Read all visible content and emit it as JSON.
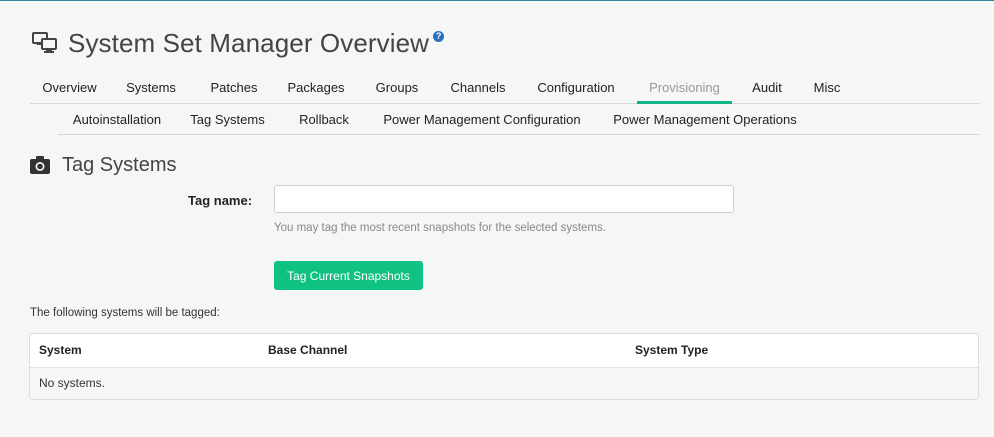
{
  "header": {
    "title": "System Set Manager Overview",
    "help_glyph": "?"
  },
  "tabs": [
    {
      "label": "Overview",
      "active": false
    },
    {
      "label": "Systems",
      "active": false
    },
    {
      "label": "Patches",
      "active": false
    },
    {
      "label": "Packages",
      "active": false
    },
    {
      "label": "Groups",
      "active": false
    },
    {
      "label": "Channels",
      "active": false
    },
    {
      "label": "Configuration",
      "active": false
    },
    {
      "label": "Provisioning",
      "active": true
    },
    {
      "label": "Audit",
      "active": false
    },
    {
      "label": "Misc",
      "active": false
    }
  ],
  "subtabs": [
    {
      "label": "Autoinstallation",
      "active": false
    },
    {
      "label": "Tag Systems",
      "active": true
    },
    {
      "label": "Rollback",
      "active": false
    },
    {
      "label": "Power Management Configuration",
      "active": false
    },
    {
      "label": "Power Management Operations",
      "active": false
    }
  ],
  "section": {
    "title": "Tag Systems",
    "icon": "camera-icon"
  },
  "form": {
    "tag_name_label": "Tag name:",
    "tag_name_value": "",
    "tag_name_placeholder": "",
    "help_text": "You may tag the most recent snapshots for the selected systems.",
    "submit_label": "Tag Current Snapshots"
  },
  "systems_table": {
    "intro": "The following systems will be tagged:",
    "columns": [
      "System",
      "Base Channel",
      "System Type"
    ],
    "empty_message": "No systems."
  },
  "colors": {
    "accent": "#10b585",
    "button": "#10c282",
    "help_icon": "#2a6fbd"
  }
}
